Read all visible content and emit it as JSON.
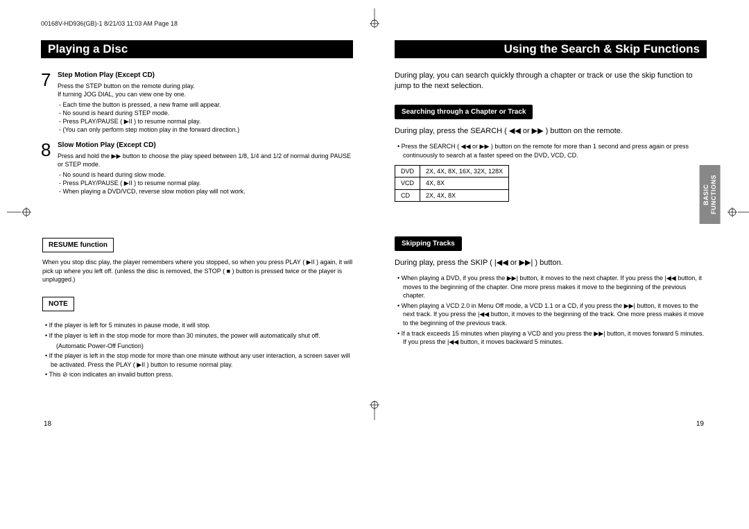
{
  "header_line": "00168V-HD936(GB)-1  8/21/03 11:03 AM  Page 18",
  "left_page": {
    "title": "Playing a Disc",
    "step7": {
      "num": "7",
      "title": "Step Motion Play (Except CD)",
      "line1": "Press the STEP button on the remote during play.",
      "line2": "If turning JOG DIAL, you can view one by one.",
      "b1": "Each time the button is pressed, a new frame will appear.",
      "b2": "No sound is heard during STEP mode.",
      "b3": "Press PLAY/PAUSE ( ▶II ) to resume normal play.",
      "b4": "(You can only perform step motion play in the forward direction.)"
    },
    "step8": {
      "num": "8",
      "title": "Slow Motion Play (Except CD)",
      "line1": "Press and hold the ▶▶ button to choose the play speed between 1/8, 1/4 and 1/2 of normal during PAUSE or STEP mode.",
      "b1": "No sound is heard during slow mode.",
      "b2": "Press PLAY/PAUSE ( ▶II ) to resume normal play.",
      "b3": "When playing a DVD/VCD, reverse slow motion play will not work."
    },
    "resume": {
      "label": "RESUME function",
      "body": "When you stop disc play, the player remembers where you stopped, so when you press PLAY ( ▶II ) again, it will pick up where you left off. (unless the disc is removed, the STOP ( ■ ) button is pressed twice or the player is unplugged.)"
    },
    "note": {
      "label": "NOTE",
      "n1": "If the player is left for 5 minutes in pause mode, it will stop.",
      "n2": "If the player is left in the stop mode for more than 30 minutes, the power will automatically shut off.",
      "n2sub": "(Automatic Power-Off Function)",
      "n3": "If the player is left in the stop mode for more than one minute without any user interaction, a screen saver will be activated. Press the PLAY ( ▶II ) button to resume normal play.",
      "n4": "This ⊘ icon indicates an invalid button press."
    },
    "page_num": "18"
  },
  "right_page": {
    "title": "Using the Search & Skip Functions",
    "intro": "During play, you can search quickly through a chapter or track or use the skip function to jump to the next selection.",
    "search": {
      "label": "Searching through a Chapter or Track",
      "instr": "During play, press the SEARCH ( ◀◀ or ▶▶ ) button on the remote.",
      "n1": "Press the SEARCH ( ◀◀ or ▶▶ ) button on the remote for more than 1 second and press again or press continuously to search at a faster speed on the DVD, VCD, CD.",
      "table": {
        "r1c1": "DVD",
        "r1c2": "2X, 4X, 8X, 16X, 32X, 128X",
        "r2c1": "VCD",
        "r2c2": "4X, 8X",
        "r3c1": "CD",
        "r3c2": "2X, 4X, 8X"
      }
    },
    "skip": {
      "label": "Skipping Tracks",
      "instr": "During play, press the SKIP ( |◀◀ or ▶▶| ) button.",
      "n1": "When playing a DVD, if you press the ▶▶| button, it moves to the next chapter. If you press the |◀◀ button, it moves to the beginning of the chapter. One more press makes it move to the beginning of the previous chapter.",
      "n2": "When playing a VCD 2.0 in Menu Off mode, a VCD 1.1 or a CD, if you press the ▶▶| button, it moves to the next track. If you press the |◀◀ button, it moves to the beginning of the track. One more press makes it move to the beginning of the previous track.",
      "n3": "If a track exceeds 15 minutes when playing a VCD and you press the ▶▶| button, it moves forward 5 minutes. If you press the |◀◀ button, it moves backward 5 minutes."
    },
    "side_tab_line1": "BASIC",
    "side_tab_line2": "FUNCTIONS",
    "page_num": "19"
  }
}
